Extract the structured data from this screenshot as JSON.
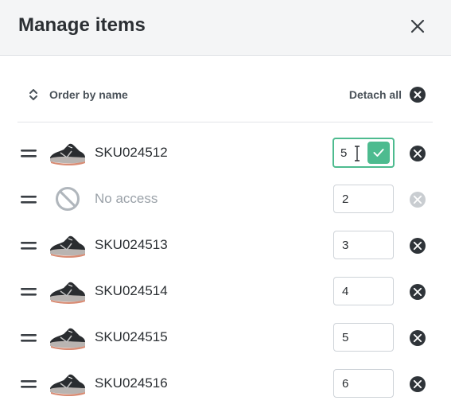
{
  "dialog": {
    "title": "Manage items",
    "close_icon": "close-icon"
  },
  "toolbar": {
    "order_label": "Order by name",
    "order_icon": "sort-icon",
    "detach_all_label": "Detach all",
    "detach_all_icon": "remove-circle-icon"
  },
  "items": [
    {
      "sku": "SKU024512",
      "quantity": "5",
      "thumbnail": "sneaker-icon",
      "editing": true,
      "accessible": true
    },
    {
      "sku": "No access",
      "quantity": "2",
      "thumbnail": "no-access-icon",
      "editing": false,
      "accessible": false
    },
    {
      "sku": "SKU024513",
      "quantity": "3",
      "thumbnail": "sneaker-icon",
      "editing": false,
      "accessible": true
    },
    {
      "sku": "SKU024514",
      "quantity": "4",
      "thumbnail": "sneaker-icon",
      "editing": false,
      "accessible": true
    },
    {
      "sku": "SKU024515",
      "quantity": "5",
      "thumbnail": "sneaker-icon",
      "editing": false,
      "accessible": true
    },
    {
      "sku": "SKU024516",
      "quantity": "6",
      "thumbnail": "sneaker-icon",
      "editing": false,
      "accessible": true
    }
  ],
  "colors": {
    "accent": "#4dbb8f",
    "header_bg": "#f4f5f6",
    "icon_dark": "#2f3439",
    "icon_disabled": "#c9cdd1",
    "muted_text": "#9aa1a8"
  }
}
